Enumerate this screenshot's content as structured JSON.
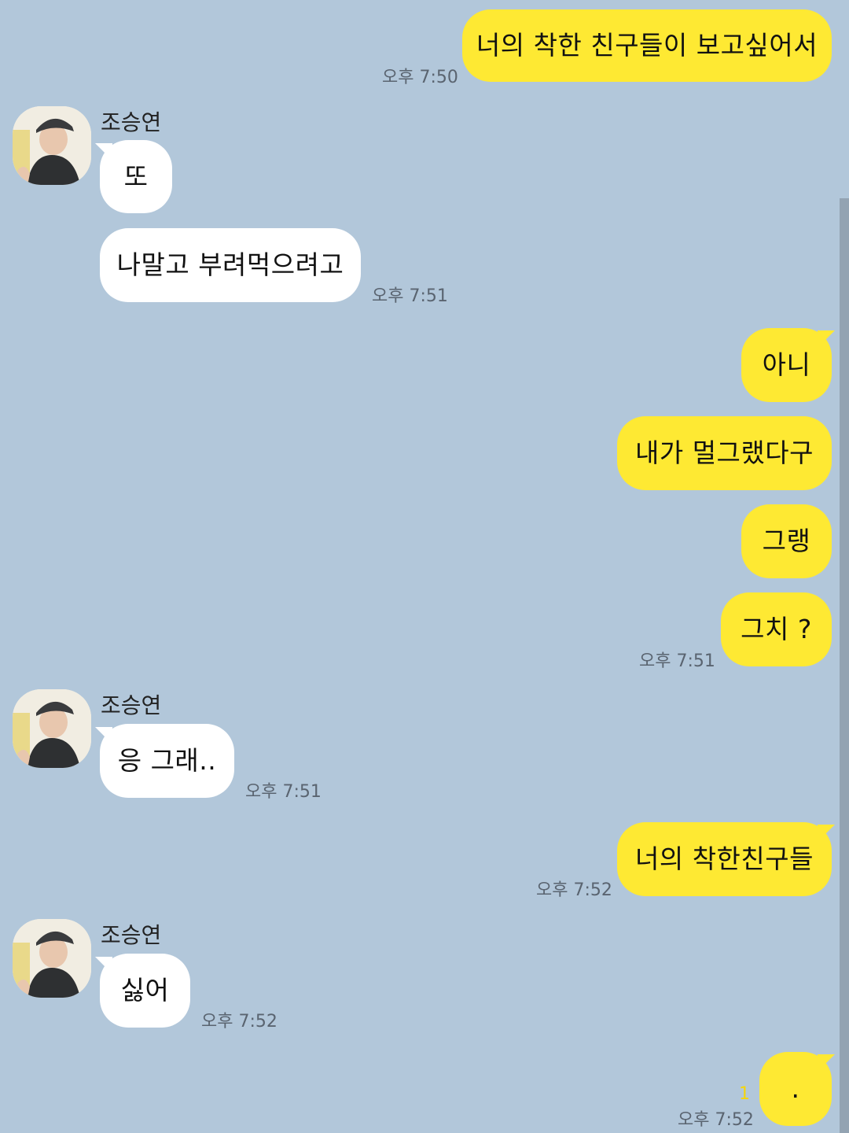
{
  "chat": {
    "contact_name": "조승연",
    "messages": [
      {
        "id": "m1",
        "sender": "me",
        "text": "너의 착한 친구들이 보고싶어서",
        "time": "오후 7:50"
      },
      {
        "id": "m2",
        "sender": "other",
        "text": "또"
      },
      {
        "id": "m3",
        "sender": "other",
        "text": "나말고 부려먹으려고",
        "time": "오후 7:51"
      },
      {
        "id": "m4",
        "sender": "me",
        "text": "아니"
      },
      {
        "id": "m5",
        "sender": "me",
        "text": "내가 멀그랬다구"
      },
      {
        "id": "m6",
        "sender": "me",
        "text": "그랭"
      },
      {
        "id": "m7",
        "sender": "me",
        "text": "그치 ?",
        "time": "오후 7:51"
      },
      {
        "id": "m8",
        "sender": "other",
        "text": "응 그래..",
        "time": "오후 7:51"
      },
      {
        "id": "m9",
        "sender": "me",
        "text": "너의 착한친구들",
        "time": "오후 7:52"
      },
      {
        "id": "m10",
        "sender": "other",
        "text": "싫어",
        "time": "오후 7:52"
      },
      {
        "id": "m11",
        "sender": "me",
        "text": ".",
        "time": "오후 7:52",
        "unread_count": "1"
      }
    ]
  },
  "colors": {
    "background": "#b2c7da",
    "my_bubble": "#fee933",
    "other_bubble": "#ffffff",
    "timestamp": "#5a6470",
    "unread": "#f5d60a"
  },
  "icons": {
    "avatar": "profile-photo-icon"
  }
}
